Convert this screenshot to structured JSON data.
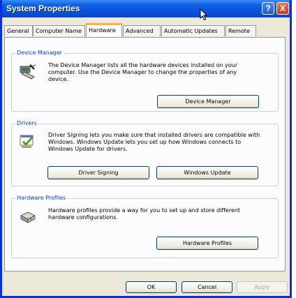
{
  "window": {
    "title": "System Properties",
    "help_glyph": "?",
    "close_glyph": "X"
  },
  "tabs": [
    {
      "label": "General"
    },
    {
      "label": "Computer Name"
    },
    {
      "label": "Hardware"
    },
    {
      "label": "Advanced"
    },
    {
      "label": "Automatic Updates"
    },
    {
      "label": "Remote"
    }
  ],
  "active_tab": "Hardware",
  "device_manager": {
    "title": "Device Manager",
    "description": "The Device Manager lists all the hardware devices installed on your computer. Use the Device Manager to change the properties of any device.",
    "button": "Device Manager"
  },
  "drivers": {
    "title": "Drivers",
    "description": "Driver Signing lets you make sure that installed drivers are compatible with Windows. Windows Update lets you set up how Windows connects to Windows Update for drivers.",
    "signing_button": "Driver Signing",
    "update_button": "Windows Update"
  },
  "hardware_profiles": {
    "title": "Hardware Profiles",
    "description": "Hardware profiles provide a way for you to set up and store different hardware configurations.",
    "button": "Hardware Profiles"
  },
  "footer": {
    "ok": "OK",
    "cancel": "Cancel",
    "apply": "Apply"
  },
  "colors": {
    "titlebar": "#0a50d8",
    "group_title": "#0046d5",
    "active_tab_accent": "#f8b33c"
  }
}
